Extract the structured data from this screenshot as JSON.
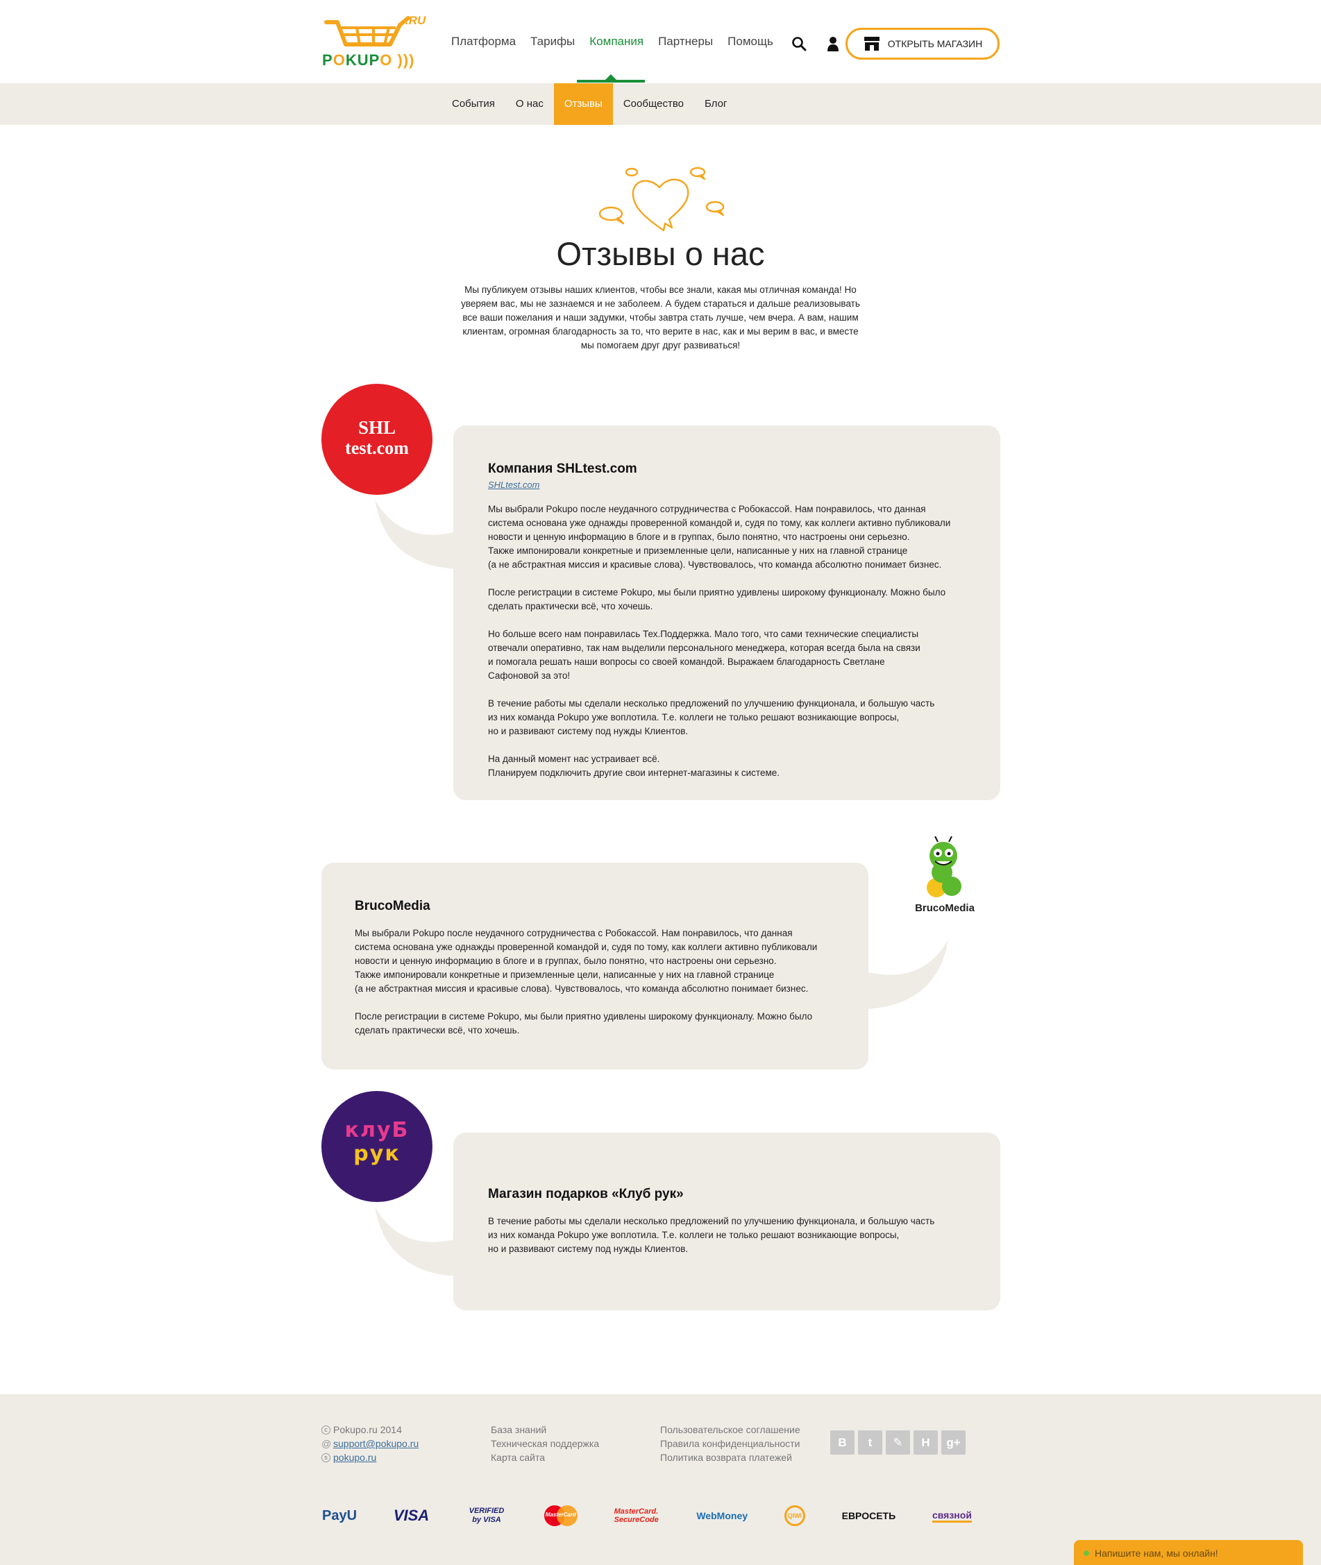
{
  "header": {
    "logo_ru": ".RU",
    "logo_word_a": "P",
    "logo_word_o1": "O",
    "logo_word_b": "KUP",
    "logo_word_o2": "O",
    "nav": [
      {
        "label": "Платформа",
        "active": false
      },
      {
        "label": "Тарифы",
        "active": false
      },
      {
        "label": "Компания",
        "active": true
      },
      {
        "label": "Партнеры",
        "active": false
      },
      {
        "label": "Помощь",
        "active": false
      }
    ],
    "open_shop_label": "ОТКРЫТЬ МАГАЗИН"
  },
  "subnav": [
    {
      "label": "События",
      "active": false
    },
    {
      "label": "О нас",
      "active": false
    },
    {
      "label": "Отзывы",
      "active": true
    },
    {
      "label": "Сообщество",
      "active": false
    },
    {
      "label": "Блог",
      "active": false
    }
  ],
  "hero": {
    "title": "Отзывы о нас",
    "intro": "Мы публикуем отзывы наших клиентов, чтобы все знали, какая мы отличная команда! Но уверяем вас, мы не зазнаемся и не заболеем. А будем стараться и дальше реализовывать все ваши пожелания и наши задумки, чтобы завтра стать лучше, чем вчера. А вам, нашим клиентам, огромная благодарность за то, что верите в нас, как и мы верим в вас, и вместе мы помогаем друг друг развиваться!"
  },
  "reviews": [
    {
      "avatar_text_1": "SHL",
      "avatar_text_2": "test.com",
      "company": "Компания SHLtest.com",
      "link": "SHLtest.com",
      "paragraphs": [
        "Мы выбрали Pokupo после неудачного сотрудничества с Робокассой. Нам понравилось, что данная\nсистема основана уже однажды проверенной командой и, судя по тому, как коллеги активно публиковали\nновости и ценную информацию в блоге и в группах, было понятно, что настроены они серьезно.\nТакже импонировали конкретные и приземленные цели, написанные у них на главной странице\n(а не абстрактная миссия и красивые слова). Чувствовалось, что команда абсолютно понимает бизнес.",
        "После регистрации в системе Pokupo, мы были приятно удивлены широкому функционалу. Можно было\nсделать практически всё, что хочешь.",
        "Но больше всего нам понравилась Тех.Поддержка. Мало того, что сами технические специалисты\nотвечали оперативно, так нам выделили персонального менеджера, которая всегда была на связи\nи помогала решать наши вопросы со своей командой. Выражаем благодарность Светлане\nСафоновой за это!",
        "В течение работы мы сделали несколько предложений по улучшению функционала, и большую часть\nиз них команда Pokupo уже воплотила. Т.е. коллеги не только решают возникающие вопросы,\nно и развивают систему под нужды Клиентов.",
        "На данный момент нас устраивает всё.\nПланируем подключить другие свои интернет-магазины к системе."
      ]
    },
    {
      "avatar_caption": "BrucoMedia",
      "company": "BrucoMedia",
      "paragraphs": [
        "Мы выбрали Pokupo после неудачного сотрудничества с Робокассой. Нам понравилось, что данная\nсистема основана уже однажды проверенной командой и, судя по тому, как коллеги активно публиковали\nновости и ценную информацию в блоге и в группах, было понятно, что настроены они серьезно.\nТакже импонировали конкретные и приземленные цели, написанные у них на главной странице\n(а не абстрактная миссия и красивые слова). Чувствовалось, что команда абсолютно понимает бизнес.",
        "После регистрации в системе Pokupo, мы были приятно удивлены широкому функционалу. Можно было\nсделать практически всё, что хочешь."
      ]
    },
    {
      "avatar_text_1": "клуБ",
      "avatar_text_2": "рук",
      "company": "Магазин подарков «Клуб рук»",
      "paragraphs": [
        "В течение работы мы сделали несколько предложений по улучшению функционала, и большую часть\nиз них команда Pokupo уже воплотила. Т.е. коллеги не только решают возникающие вопросы,\nно и развивают систему под нужды Клиентов."
      ]
    }
  ],
  "footer": {
    "copyright": "Pokupo.ru 2014",
    "email": "support@pokupo.ru",
    "skype": "pokupo.ru",
    "col2": [
      "База знаний",
      "Техническая поддержка",
      "Карта сайта"
    ],
    "col3": [
      "Пользовательское соглашение",
      "Правила конфиденциальности",
      "Политика возврата платежей"
    ],
    "social": [
      "В",
      "t",
      "✎",
      "Н",
      "g+"
    ],
    "payments": [
      "PayU",
      "VISA",
      "VERIFIED by VISA",
      "MasterCard",
      "MasterCard. SecureCode",
      "WebMoney",
      "QIWI",
      "ЕВРОСЕТЬ",
      "связной"
    ]
  },
  "chat": {
    "label": "Напишите нам, мы онлайн!"
  },
  "colors": {
    "brand_green": "#1a8f3a",
    "brand_orange": "#f4a51c",
    "panel": "#efece6"
  }
}
